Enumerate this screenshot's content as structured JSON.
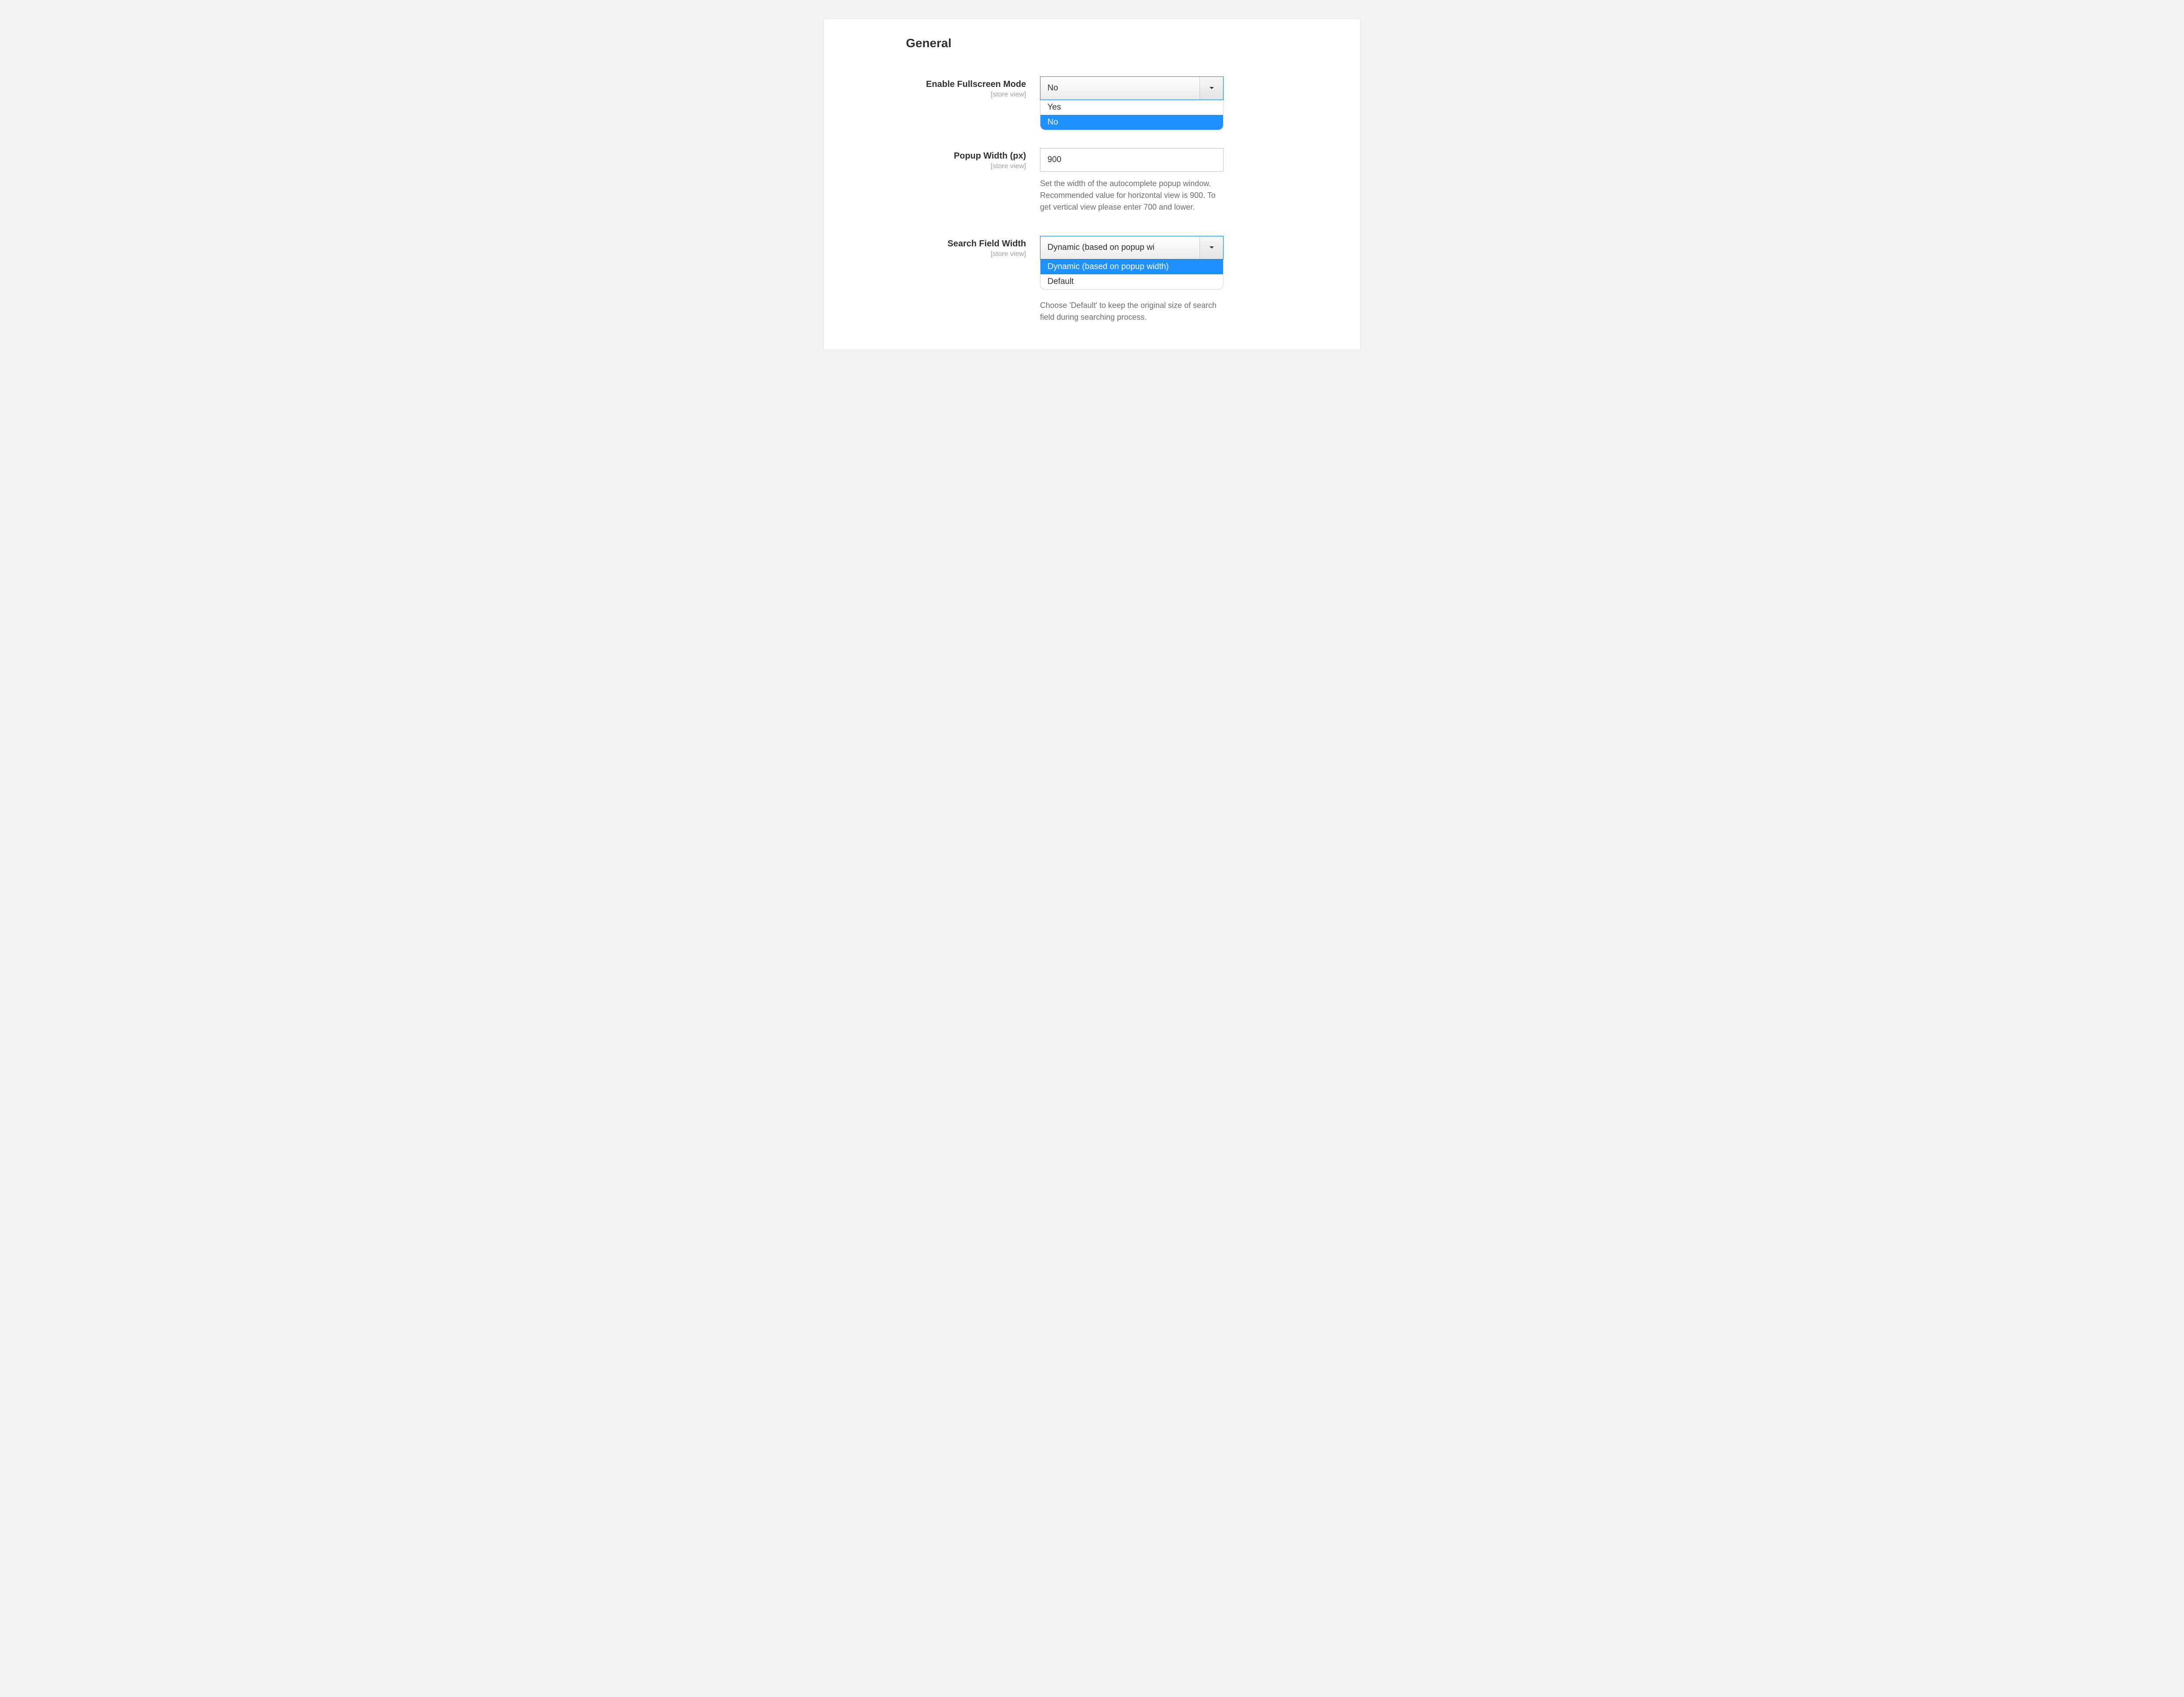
{
  "section_title": "General",
  "scope_text": "[store view]",
  "fields": {
    "fullscreen": {
      "label": "Enable Fullscreen Mode",
      "value": "No",
      "options": {
        "yes": "Yes",
        "no": "No"
      }
    },
    "popup_width": {
      "label": "Popup Width (px)",
      "value": "900",
      "help": "Set the width of the autocomplete popup window. Recommended value for horizontal view is 900. To get vertical view please enter 700 and lower."
    },
    "search_field_width": {
      "label": "Search Field Width",
      "value": "Dynamic (based on popup wi",
      "options": {
        "dynamic": "Dynamic (based on popup width)",
        "default": "Default"
      },
      "help": "Choose 'Default' to keep the original size of search field during searching process."
    }
  }
}
